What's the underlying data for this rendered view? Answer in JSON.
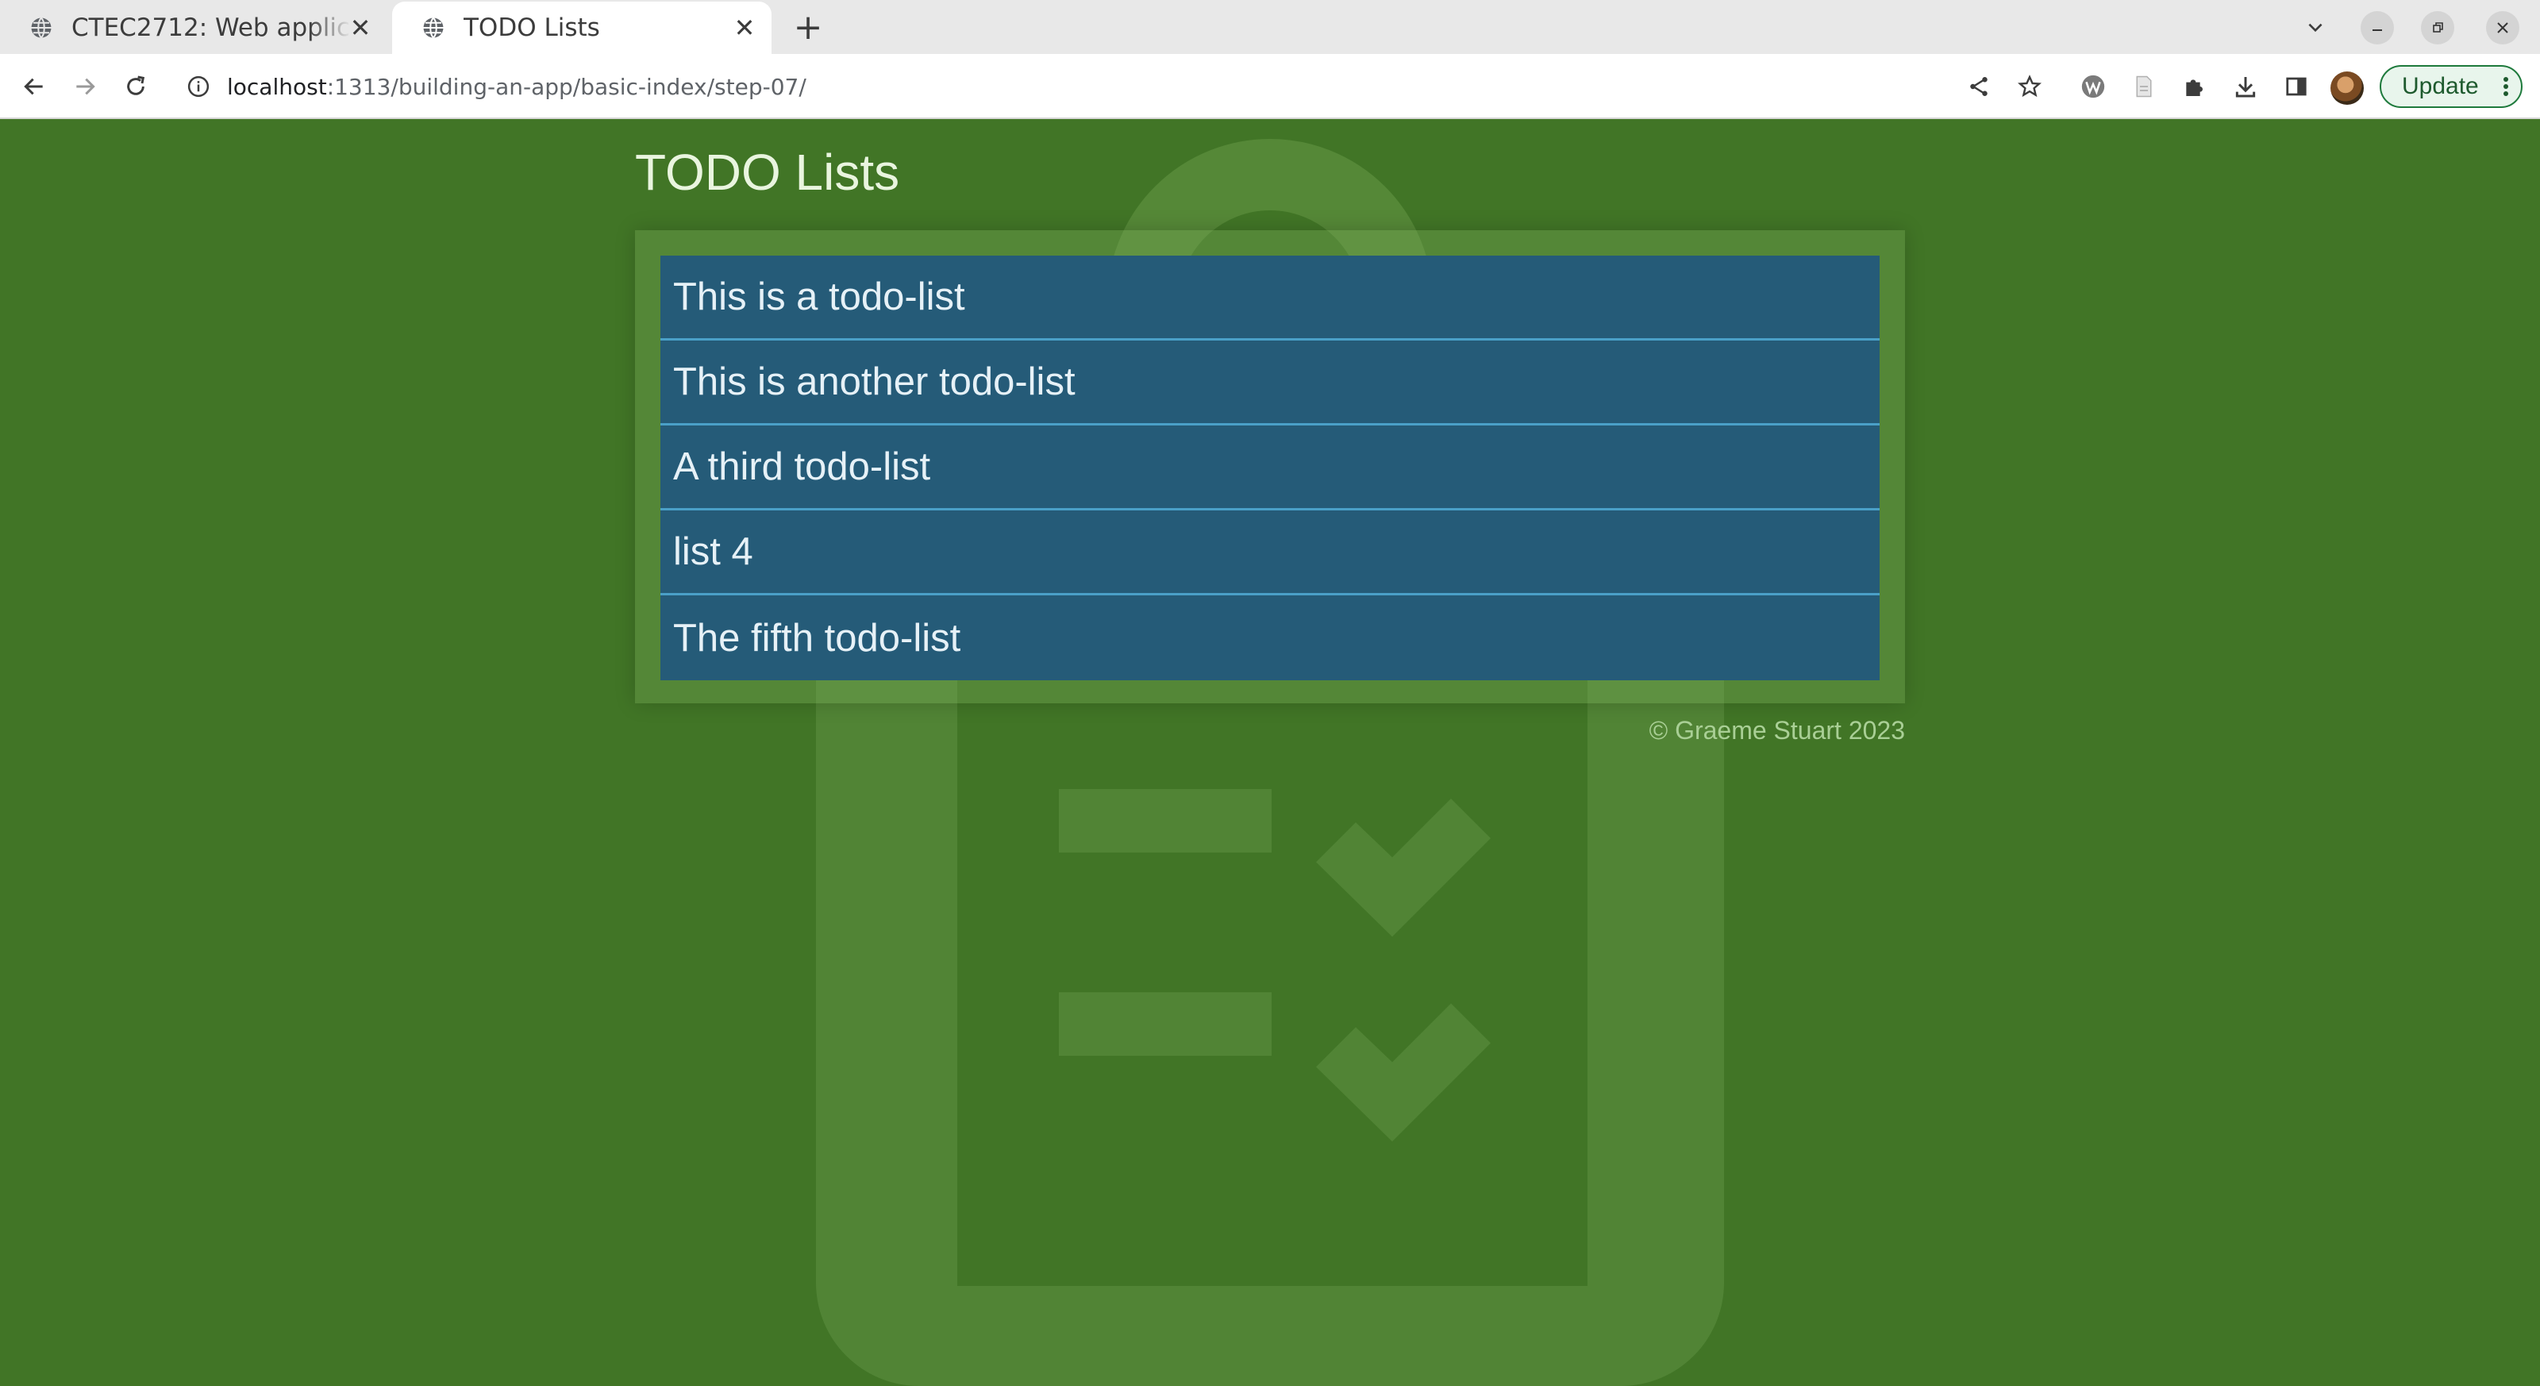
{
  "browser": {
    "tabs": [
      {
        "title": "CTEC2712: Web applicat",
        "active": false
      },
      {
        "title": "TODO Lists",
        "active": true
      }
    ],
    "new_tab_label": "+",
    "address": {
      "host": "localhost",
      "path": ":1313/building-an-app/basic-index/step-07/"
    },
    "update_label": "Update",
    "icons": {
      "tab_icon": "globe-icon",
      "back": "arrow-left-icon",
      "forward": "arrow-right-icon",
      "reload": "reload-icon",
      "info": "info-icon",
      "share": "share-icon",
      "bookmark": "star-icon",
      "wordpress": "wordpress-icon",
      "reader": "document-icon",
      "extensions": "puzzle-icon",
      "download": "download-icon",
      "side_panel": "side-panel-icon"
    }
  },
  "page": {
    "title": "TODO Lists",
    "lists": [
      "This is a todo-list",
      "This is another todo-list",
      "A third todo-list",
      "list 4",
      "The fifth todo-list"
    ],
    "footer": "© Graeme Stuart 2023",
    "colors": {
      "background": "#417526",
      "list_item": "#255b78",
      "list_divider": "#4aa0c8",
      "title_text": "#e9f5df",
      "footer_text": "#a9cf95"
    }
  }
}
